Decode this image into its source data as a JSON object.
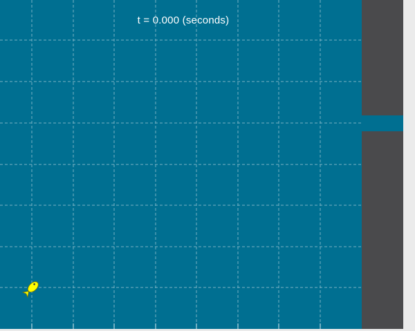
{
  "simulation": {
    "time_label": "t = 0.000 (seconds)"
  },
  "colors": {
    "water": "#006f91",
    "grid": "#9fc9d6",
    "wall": "#4a4a4c",
    "background": "#ebebeb",
    "fish": "#ffff00",
    "text": "#ffffff"
  },
  "icons": {
    "fish": "fish-icon"
  }
}
